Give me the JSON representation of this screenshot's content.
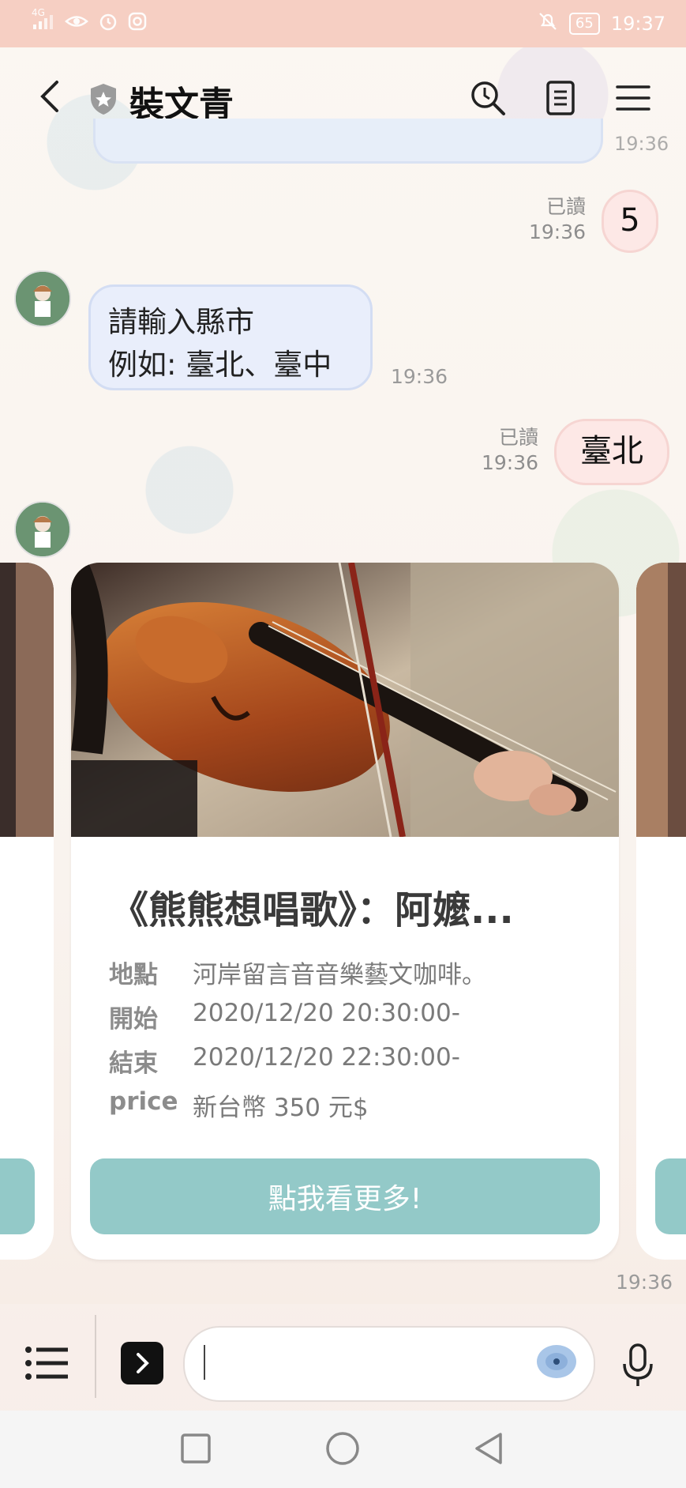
{
  "status_bar": {
    "left_icons": [
      "signal-icon",
      "eye-icon",
      "alarm-icon",
      "instagram-icon"
    ],
    "network": "4G",
    "battery": "65",
    "time": "19:37"
  },
  "header": {
    "title": "裝文青"
  },
  "messages": {
    "prev_time": "19:36",
    "reply1": {
      "read_label": "已讀",
      "time": "19:36",
      "text": "5"
    },
    "bot_prompt": {
      "line1": "請輸入縣市",
      "line2": "例如: 臺北、臺中",
      "time": "19:36"
    },
    "reply2": {
      "read_label": "已讀",
      "time": "19:36",
      "text": "臺北"
    }
  },
  "card": {
    "title": "《熊熊想唱歌》：阿嬤...",
    "rows": [
      {
        "key": "地點",
        "value": "河岸留言音音樂藝文咖啡。"
      },
      {
        "key": "開始",
        "value": "2020/12/20 20:30:00-"
      },
      {
        "key": "結束",
        "value": "2020/12/20 22:30:00-"
      },
      {
        "key": "price",
        "value": "新台幣 350 元$"
      }
    ],
    "button_label": "點我看更多!",
    "time": "19:36"
  },
  "colors": {
    "status_bar": "#f6cfc3",
    "button": "#93c9c8",
    "bot_bubble": "#e9eefb",
    "user_bubble": "#fde8e6"
  }
}
